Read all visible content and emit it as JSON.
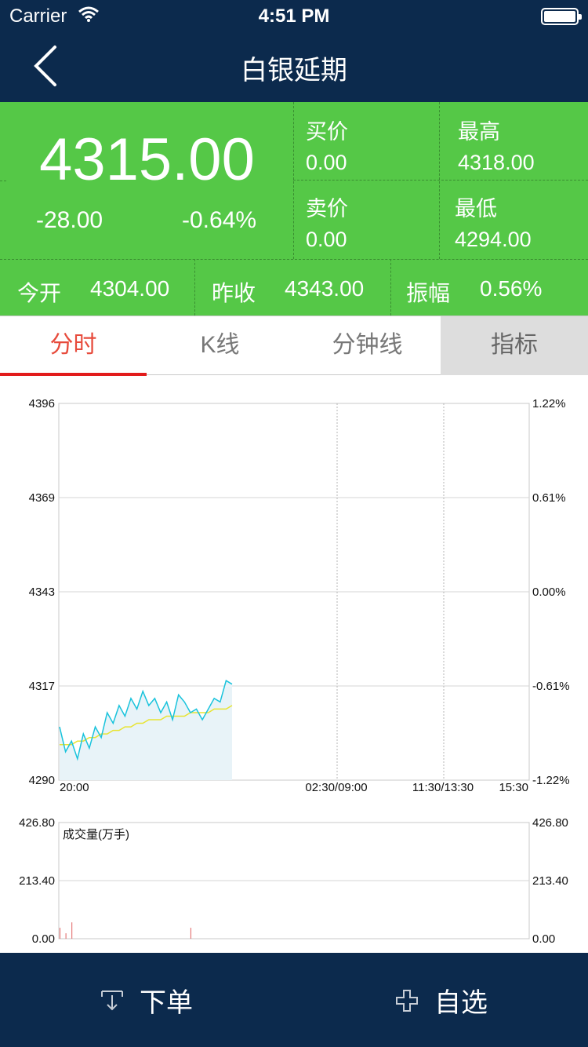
{
  "status_bar": {
    "carrier": "Carrier",
    "time": "4:51 PM"
  },
  "nav": {
    "title": "白银延期"
  },
  "quote": {
    "price": "4315.00",
    "change": "-28.00",
    "change_pct": "-0.64%",
    "bid_label": "买价",
    "bid_value": "0.00",
    "ask_label": "卖价",
    "ask_value": "0.00",
    "high_label": "最高",
    "high_value": "4318.00",
    "low_label": "最低",
    "low_value": "4294.00",
    "open_label": "今开",
    "open_value": "4304.00",
    "prev_close_label": "昨收",
    "prev_close_value": "4343.00",
    "amplitude_label": "振幅",
    "amplitude_value": "0.56%",
    "background_color": "#55c847"
  },
  "tabs": [
    {
      "label": "分时",
      "active": true
    },
    {
      "label": "K线",
      "active": false
    },
    {
      "label": "分钟线",
      "active": false
    },
    {
      "label": "指标",
      "active": false
    }
  ],
  "chart_data": {
    "type": "line",
    "price_axis_left": [
      "4396",
      "4369",
      "4343",
      "4317",
      "4290"
    ],
    "pct_axis_right": [
      "1.22%",
      "0.61%",
      "0.00%",
      "-0.61%",
      "-1.22%"
    ],
    "time_labels": [
      "20:00",
      "02:30/09:00",
      "11:30/13:30",
      "15:30"
    ],
    "ylim": [
      4290,
      4396
    ],
    "reference_price": 4343,
    "series": [
      {
        "color": "#19c3dc",
        "values": [
          4305,
          4298,
          4301,
          4296,
          4303,
          4299,
          4305,
          4302,
          4309,
          4306,
          4311,
          4308,
          4313,
          4310,
          4315,
          4311,
          4313,
          4309,
          4312,
          4307,
          4314,
          4312,
          4309,
          4310,
          4307,
          4310,
          4313,
          4312,
          4318,
          4317
        ]
      },
      {
        "color": "#e8e431",
        "values": [
          4300,
          4300,
          4300,
          4301,
          4301,
          4302,
          4302,
          4303,
          4303,
          4304,
          4304,
          4305,
          4305,
          4306,
          4306,
          4307,
          4307,
          4307,
          4308,
          4308,
          4308,
          4308,
          4309,
          4309,
          4309,
          4309,
          4310,
          4310,
          4310,
          4311
        ]
      }
    ],
    "volume": {
      "label": "成交量(万手)",
      "left_ticks": [
        "426.80",
        "213.40",
        "0.00"
      ],
      "right_ticks": [
        "426.80",
        "213.40",
        "0.00"
      ],
      "ylim": [
        0,
        426.8
      ],
      "values": [
        2,
        1,
        3,
        0,
        0,
        0,
        0,
        0,
        0,
        0,
        0,
        0,
        0,
        0,
        0,
        0,
        0,
        0,
        0,
        0,
        0,
        0,
        2,
        0,
        0,
        0,
        0,
        0,
        0,
        0
      ]
    }
  },
  "toolbar": {
    "order_label": "下单",
    "watch_label": "自选"
  }
}
